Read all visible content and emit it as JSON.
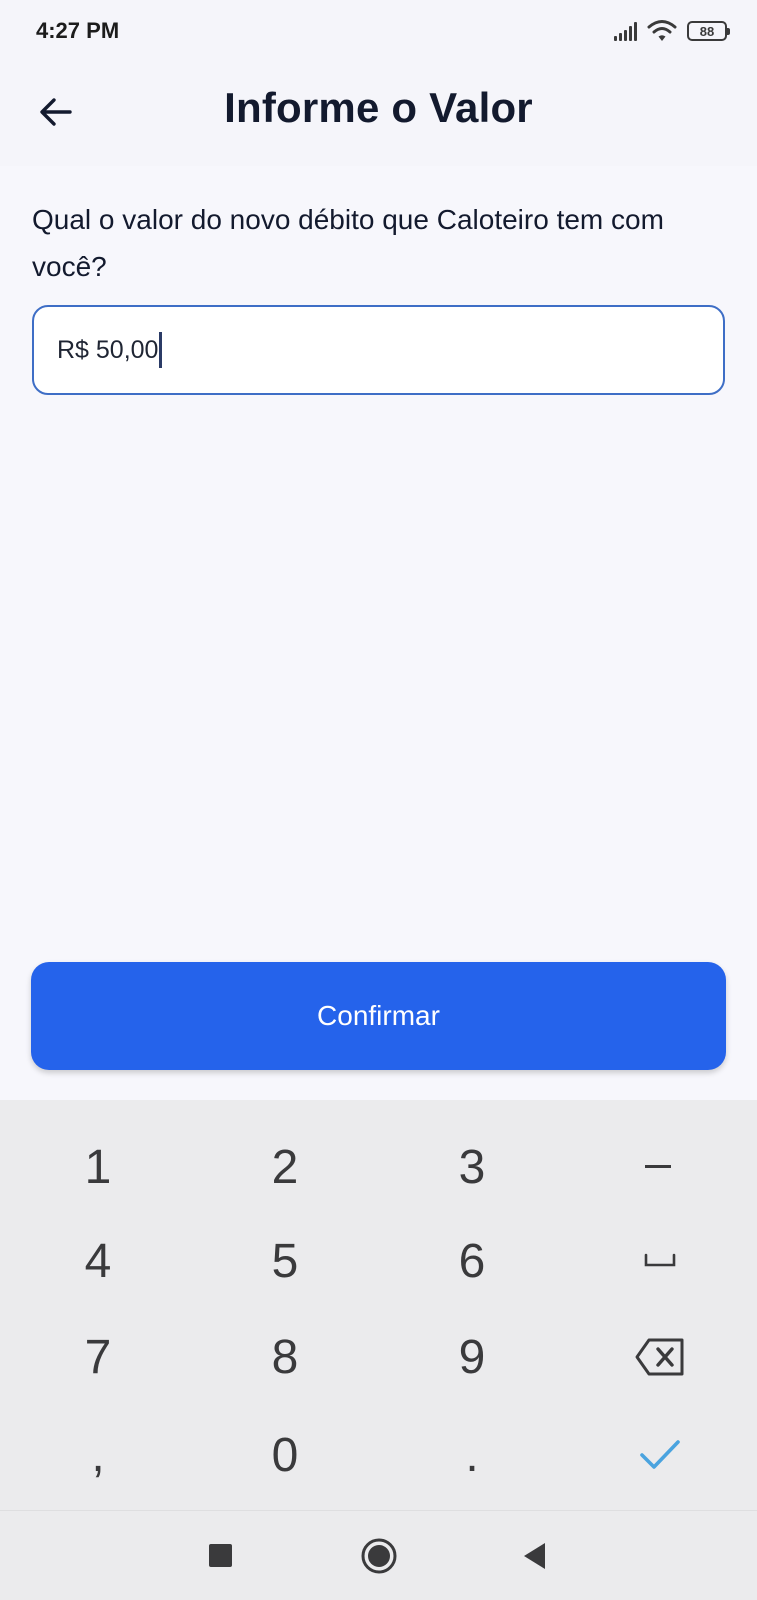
{
  "status_bar": {
    "time": "4:27 PM",
    "battery_level": "88",
    "icons": [
      "signal-icon",
      "wifi-icon",
      "battery-icon"
    ]
  },
  "app_bar": {
    "title": "Informe o Valor",
    "back_icon": "arrow-left-icon"
  },
  "form": {
    "question": "Qual o valor do novo débito que Caloteiro tem com você?",
    "amount_value": "R$ 50,00"
  },
  "confirm_button": {
    "label": "Confirmar",
    "color": "#2563eb"
  },
  "keyboard": {
    "keys": [
      "1",
      "2",
      "3",
      "−",
      "4",
      "5",
      "6",
      "␣",
      "7",
      "8",
      "9",
      "⌫",
      ",",
      "0",
      ".",
      "✓"
    ],
    "done_color": "#4aa3df"
  },
  "nav_bar": {
    "buttons": [
      "recents-square-icon",
      "home-circle-icon",
      "back-triangle-icon"
    ]
  }
}
